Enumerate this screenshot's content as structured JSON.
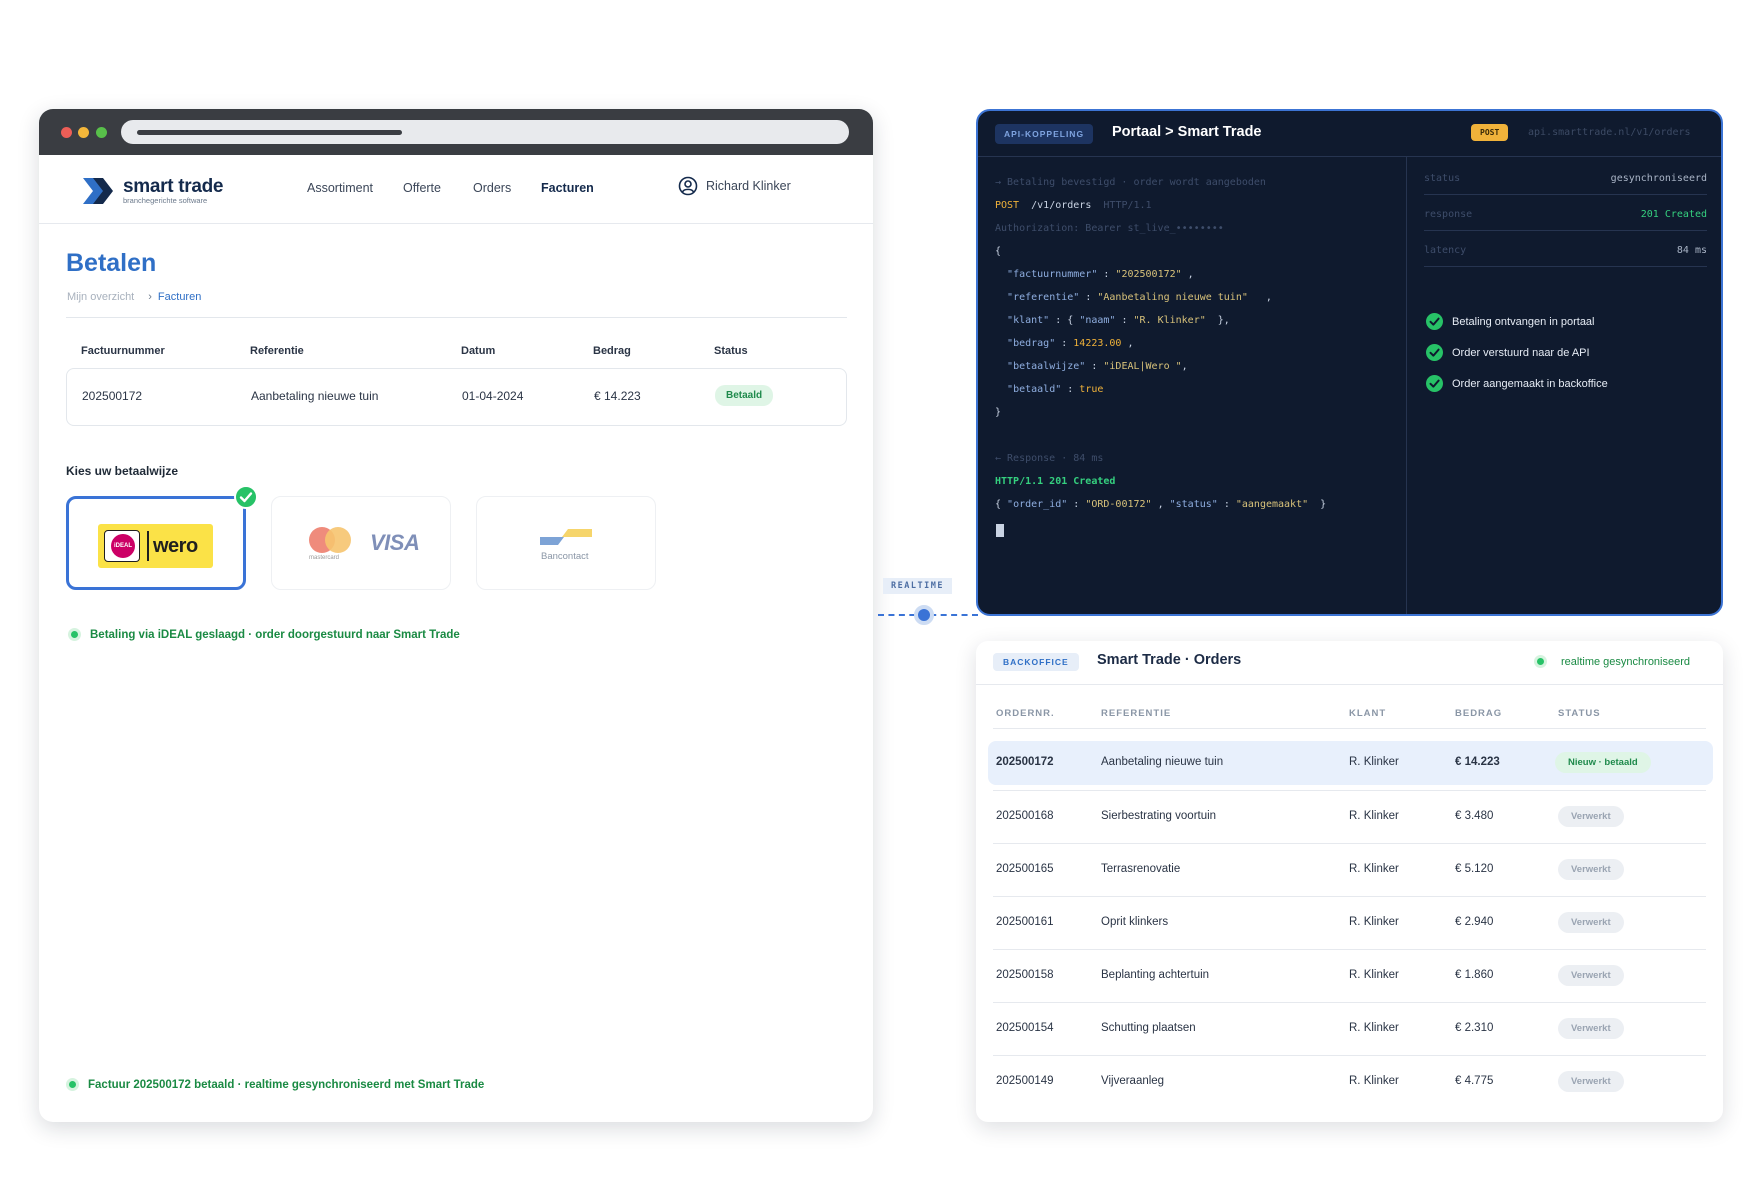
{
  "browser": {
    "logo": {
      "name": "smart trade",
      "tagline": "branchegerichte software"
    },
    "nav": [
      "Assortiment",
      "Offerte",
      "Orders",
      "Facturen"
    ],
    "nav_active": "Facturen",
    "user": "Richard Klinker",
    "page_title": "Betalen",
    "breadcrumb": [
      "Mijn overzicht",
      "Facturen"
    ],
    "breadcrumb_sep": "›",
    "invoice_table": {
      "headers": [
        "Factuurnummer",
        "Referentie",
        "Datum",
        "Bedrag",
        "Status"
      ],
      "row": {
        "number": "202500172",
        "reference": "Aanbetaling nieuwe tuin",
        "date": "01-04-2024",
        "amount": "€ 14.223",
        "status": "Betaald"
      }
    },
    "payment": {
      "label": "Kies uw betaalwijze",
      "methods": [
        {
          "name": "iDEAL | wero",
          "ideal_text": "iDEAL",
          "wero_text": "wero",
          "selected": true
        },
        {
          "name": "Mastercard / Visa",
          "mastercard_text": "mastercard",
          "visa_text": "VISA",
          "selected": false
        },
        {
          "name": "Bancontact",
          "text": "Bancontact",
          "selected": false
        }
      ]
    },
    "success_message": "Betaling via iDEAL geslaagd · order doorgestuurd naar Smart Trade",
    "footer_message": "Factuur 202500172 betaald · realtime gesynchroniseerd met Smart Trade"
  },
  "connector": {
    "label": "REALTIME"
  },
  "api": {
    "tag": "API-KOPPELING",
    "title": "Portaal > Smart Trade",
    "method": "POST",
    "url": "api.smarttrade.nl/v1/orders",
    "code": {
      "comment1": "→ Betaling bevestigd · order wordt aangeboden",
      "method": "POST",
      "path": "/v1/orders",
      "proto": "HTTP/1.1",
      "auth": "Authorization: Bearer st_live_••••••••",
      "open": "{",
      "k_factuurnummer": "\"factuurnummer\"",
      "v_factuurnummer": "\"202500172\"",
      "k_referentie": "\"referentie\"",
      "v_referentie": "\"Aanbetaling nieuwe tuin\"",
      "k_klant": "\"klant\"",
      "k_naam": "\"naam\"",
      "v_naam": "\"R. Klinker\"",
      "k_bedrag": "\"bedrag\"",
      "v_bedrag": "14223.00",
      "k_betaalwijze": "\"betaalwijze\"",
      "v_betaalwijze": "\"iDEAL|Wero \"",
      "k_betaald": "\"betaald\"",
      "v_betaald": "true",
      "close": "}",
      "comment2": "← Response · 84 ms",
      "response_status": "HTTP/1.1 201 Created",
      "k_order_id": "\"order_id\"",
      "v_order_id": "\"ORD-00172\"",
      "k_status": "\"status\"",
      "v_status": "\"aangemaakt\""
    },
    "meta": [
      {
        "key": "status",
        "value": "gesynchroniseerd"
      },
      {
        "key": "response",
        "value": "201 Created"
      },
      {
        "key": "latency",
        "value": "84 ms"
      }
    ],
    "checks": [
      "Betaling ontvangen in portaal",
      "Order verstuurd naar de API",
      "Order aangemaakt in backoffice"
    ]
  },
  "backoffice": {
    "tag": "BACKOFFICE",
    "title": "Smart Trade · Orders",
    "sync_status": "realtime gesynchroniseerd",
    "headers": [
      "ORDERNR.",
      "REFERENTIE",
      "KLANT",
      "BEDRAG",
      "STATUS"
    ],
    "rows": [
      {
        "nr": "202500172",
        "ref": "Aanbetaling nieuwe tuin",
        "klant": "R. Klinker",
        "bedrag": "€ 14.223",
        "status": "Nieuw · betaald"
      },
      {
        "nr": "202500168",
        "ref": "Sierbestrating voortuin",
        "klant": "R. Klinker",
        "bedrag": "€ 3.480",
        "status": "Verwerkt"
      },
      {
        "nr": "202500165",
        "ref": "Terrasrenovatie",
        "klant": "R. Klinker",
        "bedrag": "€ 5.120",
        "status": "Verwerkt"
      },
      {
        "nr": "202500161",
        "ref": "Oprit klinkers",
        "klant": "R. Klinker",
        "bedrag": "€ 2.940",
        "status": "Verwerkt"
      },
      {
        "nr": "202500158",
        "ref": "Beplanting achtertuin",
        "klant": "R. Klinker",
        "bedrag": "€ 1.860",
        "status": "Verwerkt"
      },
      {
        "nr": "202500154",
        "ref": "Schutting plaatsen",
        "klant": "R. Klinker",
        "bedrag": "€ 2.310",
        "status": "Verwerkt"
      },
      {
        "nr": "202500149",
        "ref": "Vijveraanleg",
        "klant": "R. Klinker",
        "bedrag": "€ 4.775",
        "status": "Verwerkt"
      }
    ]
  },
  "colors": {
    "brand_blue": "#2f6fc6",
    "success_green": "#27c267",
    "terminal_bg": "#0f1a2e",
    "post_badge": "#f0b23a"
  }
}
